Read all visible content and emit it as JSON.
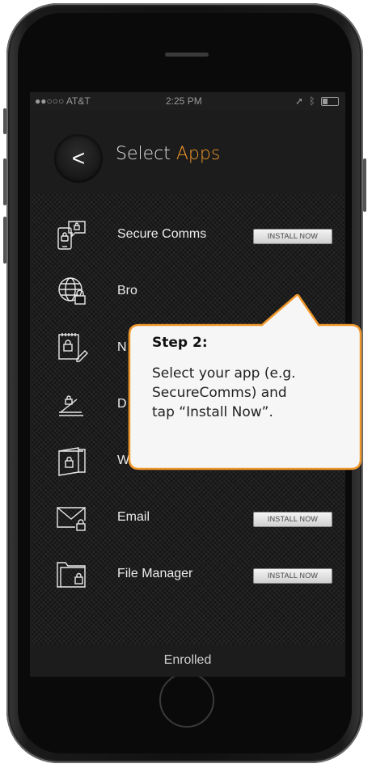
{
  "status_bar": {
    "carrier": "●●○○○ AT&T",
    "time": "2:25 PM",
    "signal_icons": "location, bluetooth, battery"
  },
  "header": {
    "back_label": "<",
    "title_main": "Select ",
    "title_accent": "Apps"
  },
  "apps": [
    {
      "label": "Secure Comms",
      "icon": "secure-comms-icon",
      "button": "INSTALL NOW"
    },
    {
      "label": "Bro",
      "icon": "browser-icon",
      "button": ""
    },
    {
      "label": "N",
      "icon": "notes-icon",
      "button": ""
    },
    {
      "label": "D",
      "icon": "documents-icon",
      "button": ""
    },
    {
      "label": "Wa",
      "icon": "wallet-icon",
      "button": ""
    },
    {
      "label": "Email",
      "icon": "email-icon",
      "button": "INSTALL NOW"
    },
    {
      "label": "File Manager",
      "icon": "file-manager-icon",
      "button": "INSTALL NOW"
    }
  ],
  "footer": {
    "label": "Enrolled"
  },
  "callout": {
    "step": "Step 2:",
    "line1": "Select your app (e.g.",
    "line2": "SecureComms) and",
    "line3": "tap “Install Now”."
  },
  "colors": {
    "accent": "#f0972b",
    "callout_border": "#f0972b",
    "callout_fill": "#f6f6f6"
  }
}
